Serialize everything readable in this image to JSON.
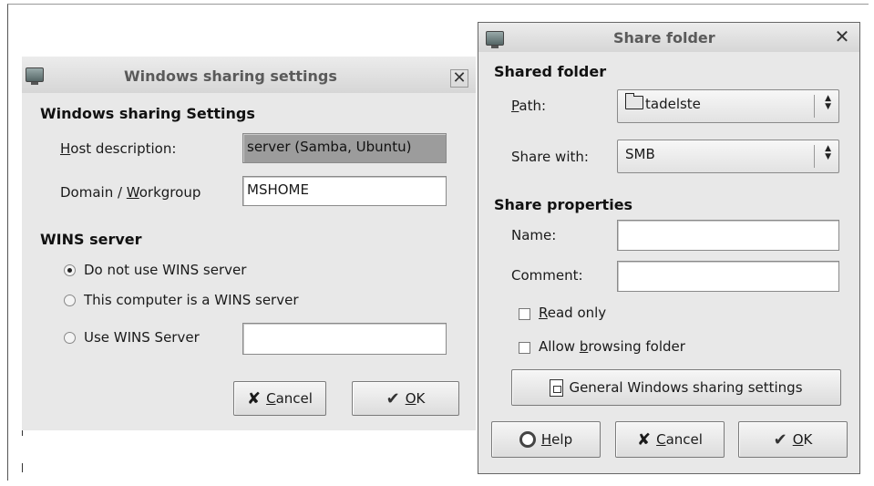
{
  "windows_dialog": {
    "title": "Windows sharing settings",
    "section_title": "Windows sharing Settings",
    "host_label_first": "H",
    "host_label_rest": "ost description:",
    "host_value": "server (Samba, Ubuntu)",
    "domain_label_pre": "Domain / ",
    "domain_label_ul": "W",
    "domain_label_rest": "orkgroup",
    "domain_value": "MSHOME",
    "wins_title": "WINS server",
    "wins_options": [
      {
        "label": "Do not use WINS server",
        "selected": true
      },
      {
        "label": "This computer is a WINS server",
        "selected": false
      },
      {
        "label": "Use WINS Server",
        "selected": false
      }
    ],
    "wins_server_value": "",
    "cancel_ul": "C",
    "cancel_rest": "ancel",
    "ok_ul": "O",
    "ok_rest": "K"
  },
  "share_dialog": {
    "title": "Share folder",
    "shared_folder_title": "Shared folder",
    "path_label_ul": "P",
    "path_label_rest": "ath:",
    "path_value": "tadelste",
    "share_with_label": "Share with:",
    "share_with_value": "SMB",
    "share_props_title": "Share properties",
    "name_label": "Name:",
    "name_value": "",
    "comment_label": "Comment:",
    "comment_value": "",
    "read_only_ul": "R",
    "read_only_rest": "ead only",
    "read_only_checked": false,
    "allow_pre": "Allow ",
    "allow_ul": "b",
    "allow_rest": "rowsing folder",
    "allow_checked": false,
    "general_settings_label": "General Windows sharing settings",
    "help_ul": "H",
    "help_rest": "elp",
    "cancel_ul": "C",
    "cancel_rest": "ancel",
    "ok_ul": "O",
    "ok_rest": "K"
  },
  "icons": {
    "window_icon": "monitor-icon",
    "close": "close-icon",
    "folder": "folder-icon",
    "cancel": "cross-icon",
    "ok": "checkmark-icon",
    "help": "help-ring-icon",
    "general": "document-icon"
  }
}
